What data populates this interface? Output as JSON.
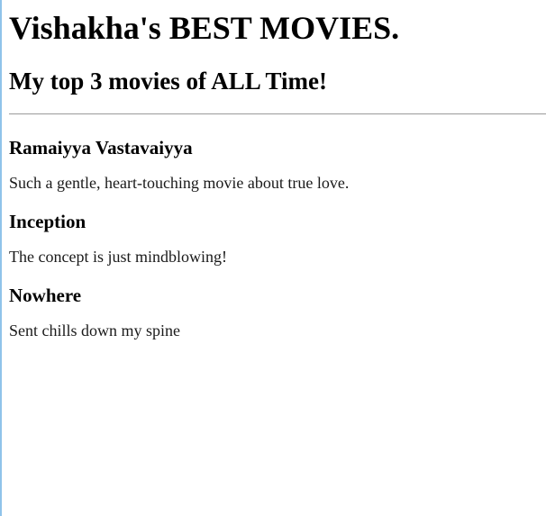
{
  "header": {
    "title": "Vishakha's BEST MOVIES.",
    "subtitle": "My top 3 movies of ALL Time!"
  },
  "movies": [
    {
      "title": "Ramaiyya Vastavaiyya",
      "description": "Such a gentle, heart-touching movie about true love."
    },
    {
      "title": "Inception",
      "description": "The concept is just mindblowing!"
    },
    {
      "title": "Nowhere",
      "description": "Sent chills down my spine"
    }
  ],
  "colors": {
    "text": "#000000",
    "divider": "#9a9a9a",
    "left_edge": "#8fc3ea"
  }
}
